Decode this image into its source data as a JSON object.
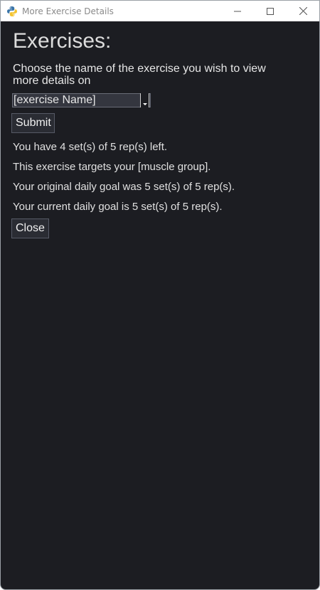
{
  "window": {
    "title": "More Exercise Details"
  },
  "main": {
    "heading": "Exercises:",
    "prompt": "Choose the name of the exercise you wish to view more details on",
    "exercise_select": {
      "selected": "[exercise Name]"
    },
    "submit_label": "Submit",
    "info_lines": [
      "You have 4 set(s) of 5 rep(s) left.",
      "This exercise targets your [muscle group].",
      "Your original daily goal was 5 set(s) of 5 rep(s).",
      "Your current daily goal is 5 set(s) of 5 rep(s)."
    ],
    "close_label": "Close"
  },
  "icons": {
    "app": "python-icon",
    "minimize": "minimize-icon",
    "maximize": "maximize-icon",
    "close": "close-icon",
    "dropdown": "chevron-down-icon"
  },
  "colors": {
    "background": "#1c1d22",
    "text": "#e0e0e0",
    "button": "#2a2c33",
    "input": "#34363f"
  }
}
